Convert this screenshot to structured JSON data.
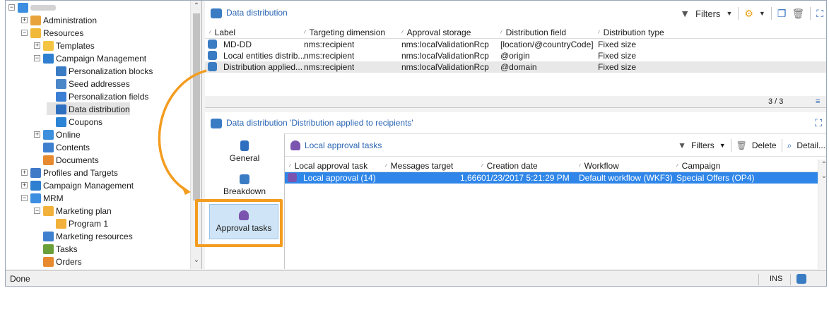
{
  "tree": {
    "items": [
      {
        "label": "",
        "toggle": "−",
        "icon": "#3b8ee0",
        "blurred": true
      },
      {
        "label": "Administration",
        "toggle": "+",
        "icon": "#e8a33a"
      },
      {
        "label": "Resources",
        "toggle": "−",
        "icon": "#f0b93a"
      },
      {
        "label": "Templates",
        "toggle": "+",
        "icon": "#f4c542"
      },
      {
        "label": "Campaign Management",
        "toggle": "−",
        "icon": "#2e7fd0"
      },
      {
        "label": "Personalization blocks",
        "toggle": "",
        "icon": "#3a7cc4"
      },
      {
        "label": "Seed addresses",
        "toggle": "",
        "icon": "#4a87c9"
      },
      {
        "label": "Personalization fields",
        "toggle": "",
        "icon": "#3b7fd4"
      },
      {
        "label": "Data distribution",
        "toggle": "",
        "icon": "#2f6fc0",
        "selected": true
      },
      {
        "label": "Coupons",
        "toggle": "",
        "icon": "#2c84d6"
      },
      {
        "label": "Online",
        "toggle": "+",
        "icon": "#3c8fdc"
      },
      {
        "label": "Contents",
        "toggle": "",
        "icon": "#3f7fcf"
      },
      {
        "label": "Documents",
        "toggle": "",
        "icon": "#e6892f"
      },
      {
        "label": "Profiles and Targets",
        "toggle": "+",
        "icon": "#3f7ac8"
      },
      {
        "label": "Campaign Management",
        "toggle": "+",
        "icon": "#2e7fd0"
      },
      {
        "label": "MRM",
        "toggle": "−",
        "icon": "#3b8ee0"
      },
      {
        "label": "Marketing plan",
        "toggle": "−",
        "icon": "#f2b13a"
      },
      {
        "label": "Program 1",
        "toggle": "",
        "icon": "#f2b13a"
      },
      {
        "label": "Marketing resources",
        "toggle": "",
        "icon": "#3f7fcf"
      },
      {
        "label": "Tasks",
        "toggle": "",
        "icon": "#6a9f3a"
      },
      {
        "label": "Orders",
        "toggle": "",
        "icon": "#e6892f"
      }
    ]
  },
  "top_panel": {
    "title": "Data distribution",
    "filters_label": "Filters",
    "columns": [
      "Label",
      "Targeting dimension",
      "Approval storage",
      "Distribution field",
      "Distribution type"
    ],
    "rows": [
      [
        "MD-DD",
        "nms:recipient",
        "nms:localValidationRcp",
        "[location/@countryCode]",
        "Fixed size"
      ],
      [
        "Local entities distrib...",
        "nms:recipient",
        "nms:localValidationRcp",
        "@origin",
        "Fixed size"
      ],
      [
        "Distribution applied...",
        "nms:recipient",
        "nms:localValidationRcp",
        "@domain",
        "Fixed size"
      ]
    ],
    "count": "3 / 3"
  },
  "detail_panel": {
    "title": "Data distribution 'Distribution applied to recipients'",
    "tabs": [
      {
        "label": "General"
      },
      {
        "label": "Breakdown"
      },
      {
        "label": "Approval tasks"
      }
    ]
  },
  "tasks": {
    "title": "Local approval tasks",
    "filters_label": "Filters",
    "delete_label": "Delete",
    "detail_label": "Detail...",
    "columns": [
      "Local approval task",
      "Messages target",
      "Creation date",
      "Workflow",
      "Campaign"
    ],
    "rows": [
      [
        "Local approval (14)",
        "1,666",
        "01/23/2017 5:21:29 PM",
        "Default workflow (WKF3)",
        "Special Offers (OP4)"
      ]
    ]
  },
  "status": {
    "text": "Done",
    "mode": "INS"
  },
  "colors": {
    "accent": "#2b66b3",
    "highlight": "#f39c1f",
    "selection": "#2f86e8"
  }
}
